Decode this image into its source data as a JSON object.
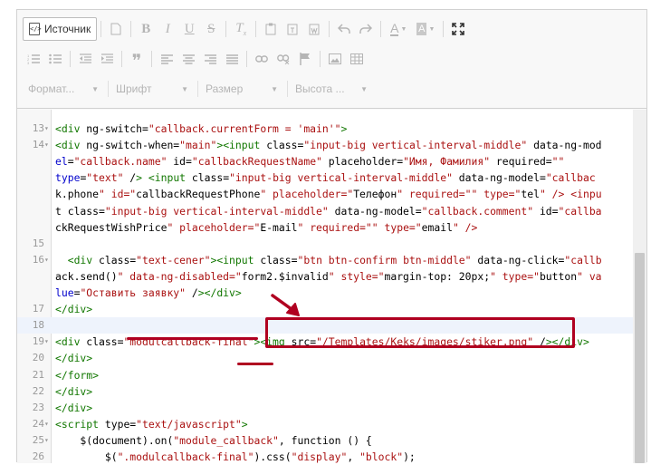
{
  "toolbar": {
    "source_label": "Источник",
    "format_label": "Формат...",
    "font_label": "Шрифт",
    "size_label": "Размер",
    "height_label": "Высота ..."
  },
  "lines": [
    {
      "num": "13",
      "fold": "▾",
      "text": "<div ng-switch=\"callback.currentForm = 'main'\">"
    },
    {
      "num": "14",
      "fold": "▾",
      "text": "<div ng-switch-when=\"main\"><input class=\"input-big vertical-interval-middle\" data-ng-mod"
    },
    {
      "num": "",
      "fold": "",
      "text": "el=\"callback.name\" id=\"callbackRequestName\" placeholder=\"Имя, Фамилия\" required=\"\""
    },
    {
      "num": "",
      "fold": "",
      "text": "type=\"text\" /> <input class=\"input-big vertical-interval-middle\" data-ng-model=\"callbac"
    },
    {
      "num": "",
      "fold": "",
      "text": "k.phone\" id=\"callbackRequestPhone\" placeholder=\"Телефон\" required=\"\" type=\"tel\" /> <inpu"
    },
    {
      "num": "",
      "fold": "",
      "text": "t class=\"input-big vertical-interval-middle\" data-ng-model=\"callback.comment\" id=\"callba"
    },
    {
      "num": "",
      "fold": "",
      "text": "ckRequestWishPrice\" placeholder=\"E-mail\" required=\"\" type=\"email\" />"
    },
    {
      "num": "15",
      "fold": "",
      "text": ""
    },
    {
      "num": "16",
      "fold": "▾",
      "text": "  <div class=\"text-cener\"><input class=\"btn btn-confirm btn-middle\" data-ng-click=\"callb"
    },
    {
      "num": "",
      "fold": "",
      "text": "ack.send()\" data-ng-disabled=\"form2.$invalid\" style=\"margin-top: 20px;\" type=\"button\" va"
    },
    {
      "num": "",
      "fold": "",
      "text": "lue=\"Оставить заявку\" /></div>"
    },
    {
      "num": "17",
      "fold": "",
      "text": "</div>"
    },
    {
      "num": "18",
      "fold": "",
      "text": ""
    },
    {
      "num": "19",
      "fold": "▾",
      "text": "<div class=\"modulcallback-final\"><img src=\"/Templates/Keks/images/stiker.png\" /></div>"
    },
    {
      "num": "20",
      "fold": "",
      "text": "</div>"
    },
    {
      "num": "21",
      "fold": "",
      "text": "</form>"
    },
    {
      "num": "22",
      "fold": "",
      "text": "</div>"
    },
    {
      "num": "23",
      "fold": "",
      "text": "</div>"
    },
    {
      "num": "24",
      "fold": "▾",
      "text": "<script type=\"text/javascript\">"
    },
    {
      "num": "25",
      "fold": "▾",
      "text": "    $(document).on(\"module_callback\", function () {"
    },
    {
      "num": "26",
      "fold": "",
      "text": "        $(\".modulcallback-final\").css(\"display\", \"block\");"
    }
  ],
  "colors": {
    "annotation": "#b00020",
    "tag": "#117700",
    "attribute": "#0000cc",
    "string": "#aa1111"
  }
}
